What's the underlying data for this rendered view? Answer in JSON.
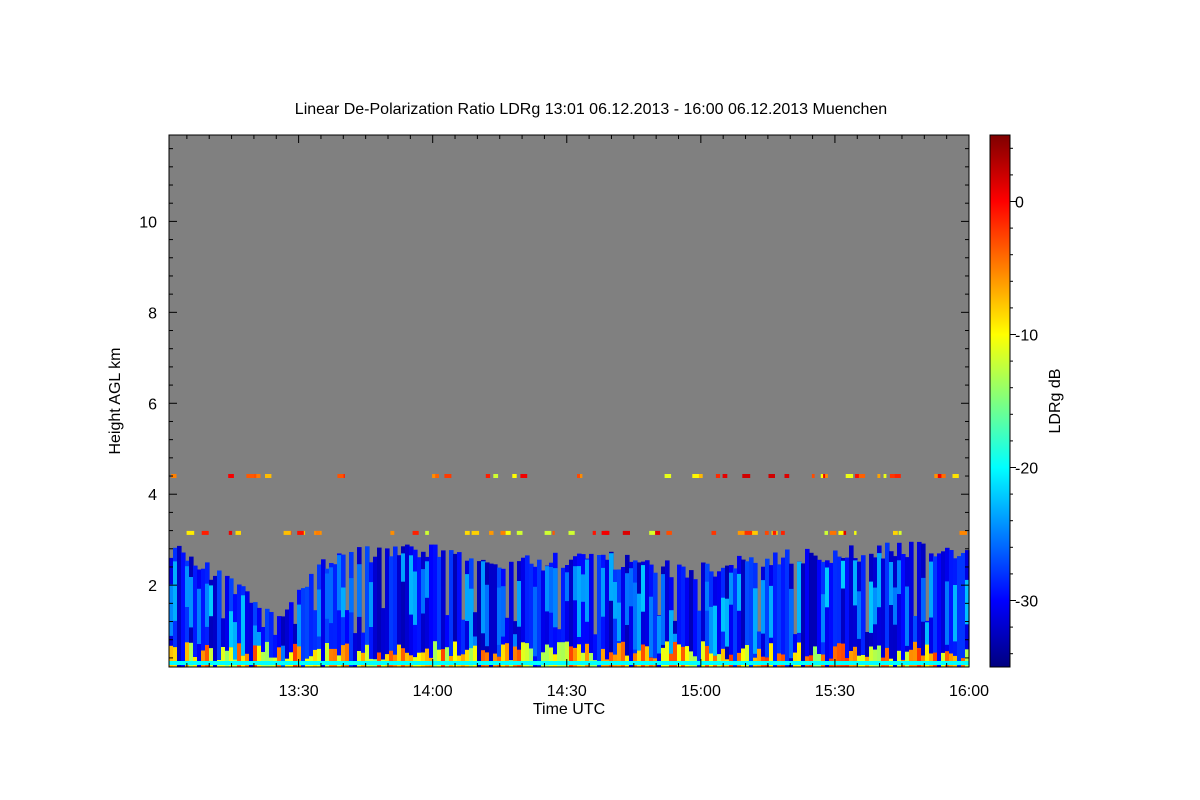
{
  "chart_data": {
    "type": "heatmap",
    "title": "Linear De-Polarization Ratio LDRg   13:01 06.12.2013 - 16:00 06.12.2013 Muenchen",
    "xlabel": "Time UTC",
    "ylabel": "Height AGL km",
    "colorbar_label": "LDRg dB",
    "x_range": [
      "13:01",
      "16:00"
    ],
    "x_ticks": [
      "13:30",
      "14:00",
      "14:30",
      "15:00",
      "15:30",
      "16:00"
    ],
    "ylim": [
      0.2,
      11.9
    ],
    "y_ticks": [
      "2",
      "4",
      "6",
      "8",
      "10"
    ],
    "colorbar_range": [
      -35,
      5
    ],
    "colorbar_ticks": [
      "0",
      "-10",
      "-20",
      "-30"
    ],
    "colormap": "jet",
    "background_color": "#808080",
    "features": {
      "cloud_top_km": [
        2.8,
        2.1,
        1.2,
        2.6,
        2.7,
        2.8,
        2.4,
        2.5,
        2.6,
        2.4,
        2.3,
        2.6,
        2.6,
        2.7,
        2.8,
        2.7
      ],
      "cloud_ldr_db": -30,
      "surface_layer_top_km": 0.7,
      "surface_layer_ldr_db": -8,
      "speckle_layers_km": [
        4.4,
        3.15
      ],
      "speckle_ldr_db": -5
    }
  }
}
